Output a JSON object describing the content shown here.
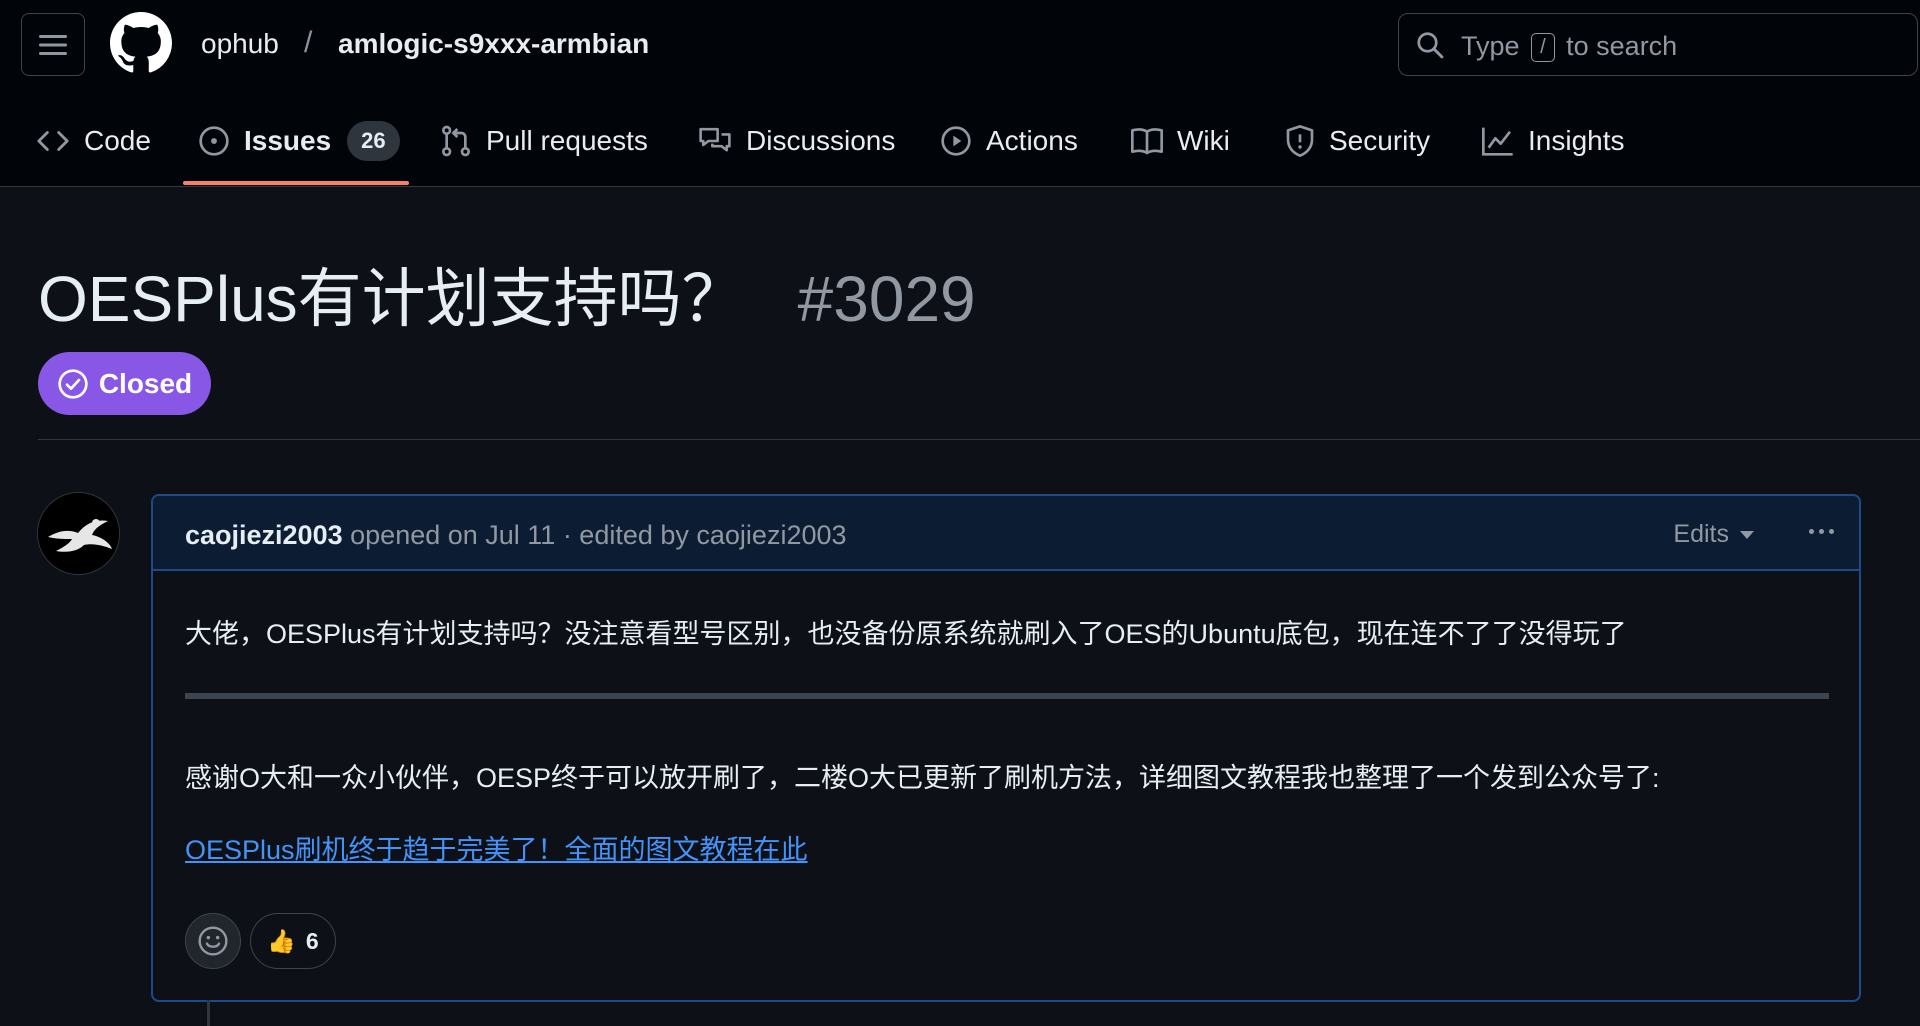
{
  "header": {
    "owner": "ophub",
    "separator": "/",
    "repo": "amlogic-s9xxx-armbian",
    "search": {
      "prefix": "Type",
      "key": "/",
      "suffix": "to search"
    }
  },
  "tabs": [
    {
      "label": "Code",
      "icon": "code-icon"
    },
    {
      "label": "Issues",
      "icon": "issue-opened-icon",
      "count": "26",
      "active": true
    },
    {
      "label": "Pull requests",
      "icon": "git-pull-request-icon"
    },
    {
      "label": "Discussions",
      "icon": "comment-discussion-icon"
    },
    {
      "label": "Actions",
      "icon": "play-icon"
    },
    {
      "label": "Wiki",
      "icon": "book-icon"
    },
    {
      "label": "Security",
      "icon": "shield-icon"
    },
    {
      "label": "Insights",
      "icon": "graph-icon"
    }
  ],
  "issue": {
    "title": "OESPlus有计划支持吗？",
    "number": "#3029",
    "state": "Closed",
    "state_color": "#8957e5"
  },
  "comment": {
    "author": "caojiezi2003",
    "meta": "opened on Jul 11 · edited by caojiezi2003",
    "edits_label": "Edits",
    "paragraph1": "大佬，OESPlus有计划支持吗？没注意看型号区别，也没备份原系统就刷入了OES的Ubuntu底包，现在连不了了没得玩了",
    "paragraph2": "感谢O大和一众小伙伴，OESP终于可以放开刷了，二楼O大已更新了刷机方法，详细图文教程我也整理了一个发到公众号了:",
    "link_text": "OESPlus刷机终于趋于完美了！全面的图文教程在此",
    "reaction": {
      "emoji": "👍",
      "count": "6"
    }
  },
  "colors": {
    "background": "#0d1117",
    "header_bg": "#010409",
    "accent_underline": "#f78166",
    "link": "#4493f8",
    "comment_border": "#1f4a8a"
  }
}
